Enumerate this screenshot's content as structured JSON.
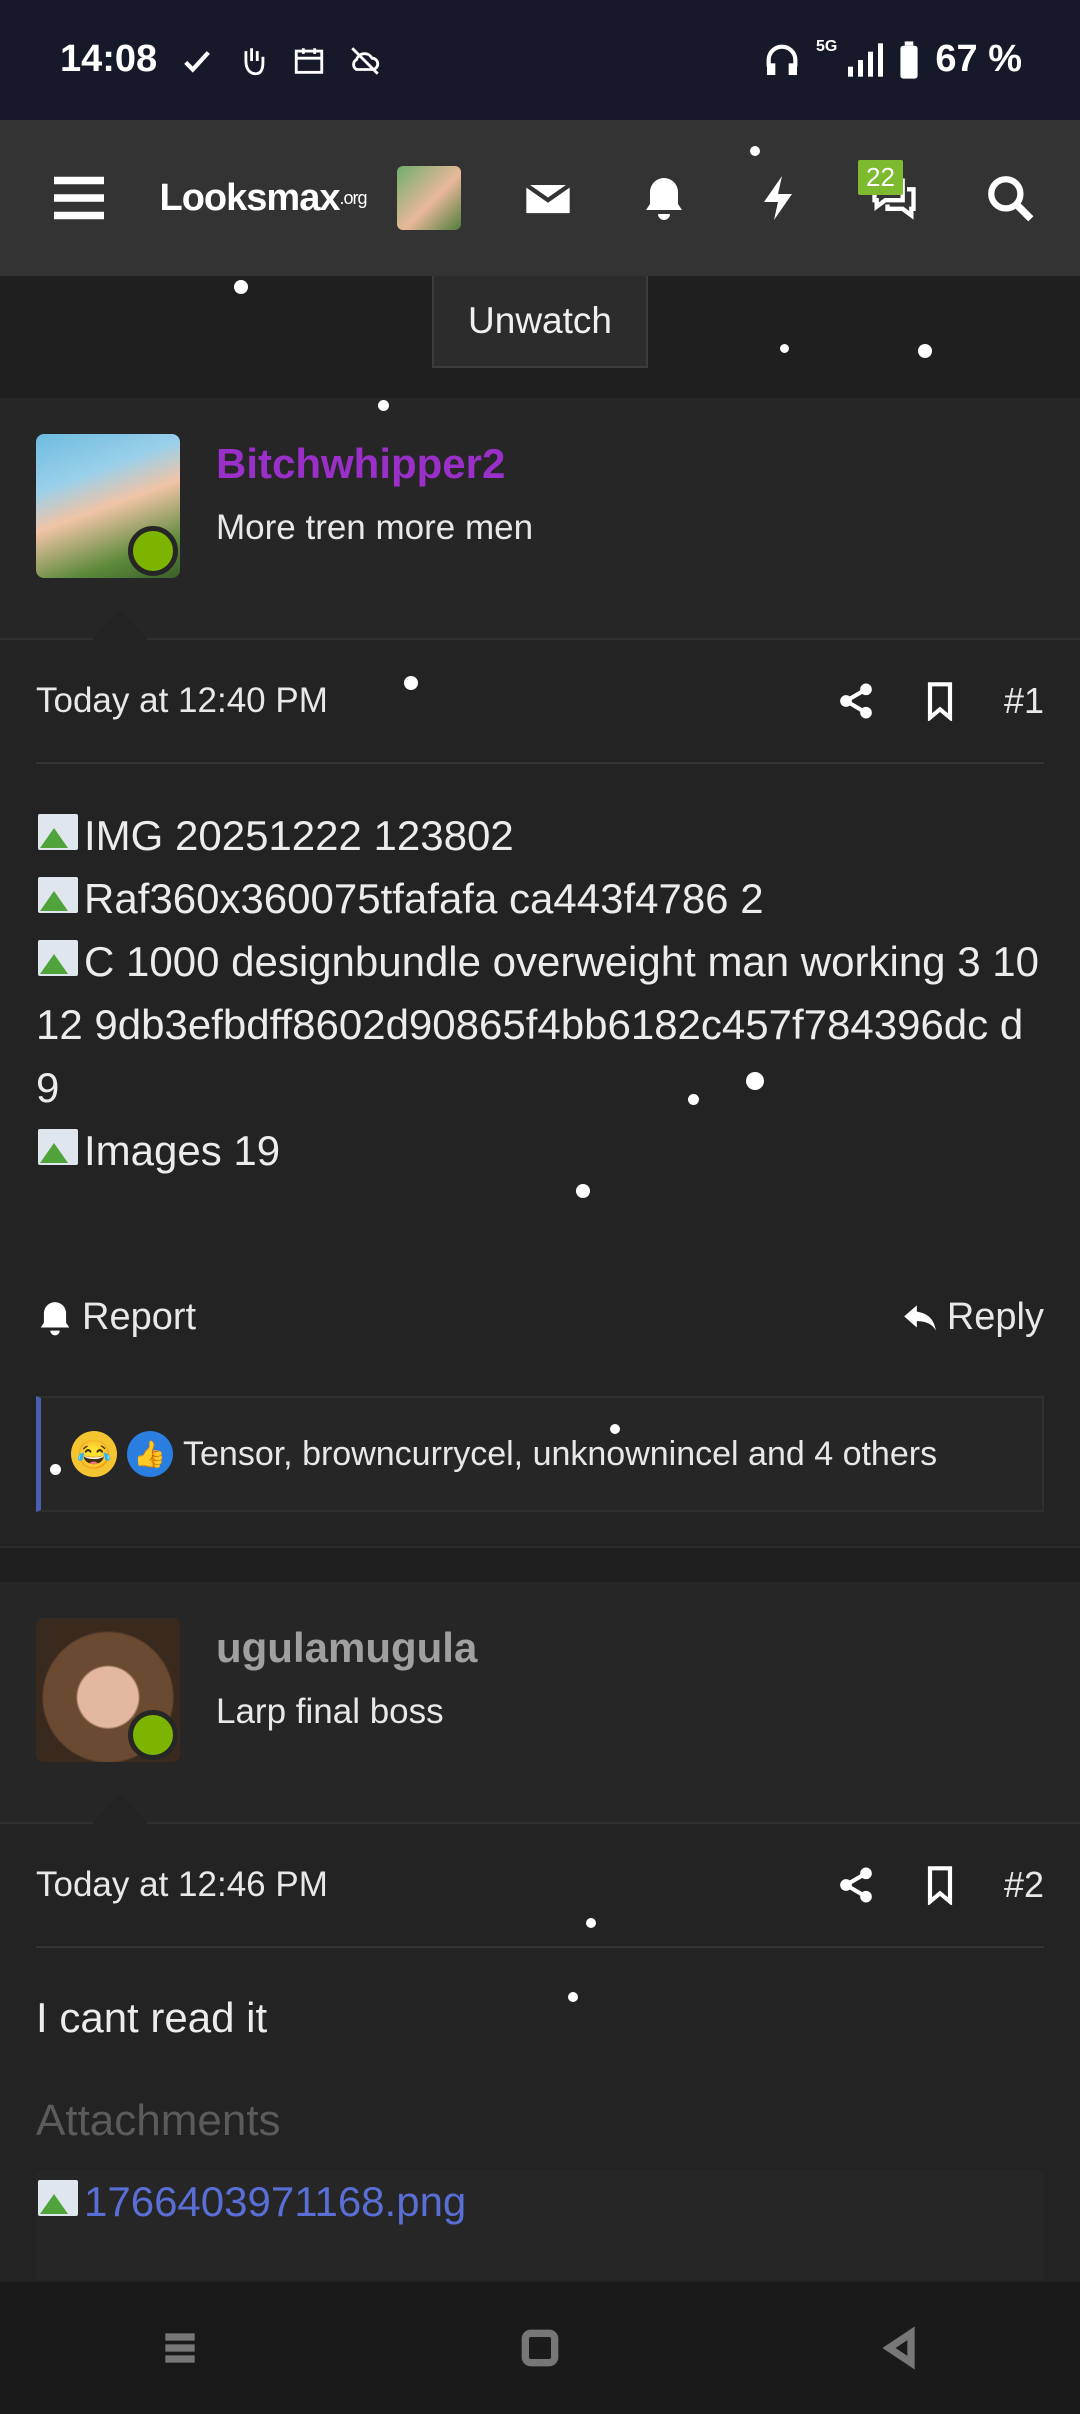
{
  "status_bar": {
    "time": "14:08",
    "battery": "67 %",
    "network": "5G"
  },
  "navbar": {
    "logo_main": "Looksmax",
    "logo_suffix": ".org",
    "notification_count": "22"
  },
  "tooltip": {
    "label": "Unwatch"
  },
  "posts": [
    {
      "username": "Bitchwhipper2",
      "username_color": "#9b2fc9",
      "user_title": "More tren more men",
      "timestamp": "Today at 12:40 PM",
      "post_number": "#1",
      "lines": [
        "IMG 20251222 123802",
        "Raf360x360075tfafafa ca443f4786 2",
        "C 1000 designbundle overweight man working 3 10 12 9db3efbdff8602d90865f4bb6182c457f784396dc d9",
        "Images 19"
      ],
      "report_label": "Report",
      "reply_label": "Reply",
      "reactions_text": "Tensor, browncurrycel, unknownincel and 4 others"
    },
    {
      "username": "ugulamugula",
      "username_color": "#a0a0a0",
      "user_title": "Larp final boss",
      "timestamp": "Today at 12:46 PM",
      "post_number": "#2",
      "text": "I cant read it",
      "attachments_heading": "Attachments",
      "attachment_name": "1766403971168.png"
    }
  ]
}
